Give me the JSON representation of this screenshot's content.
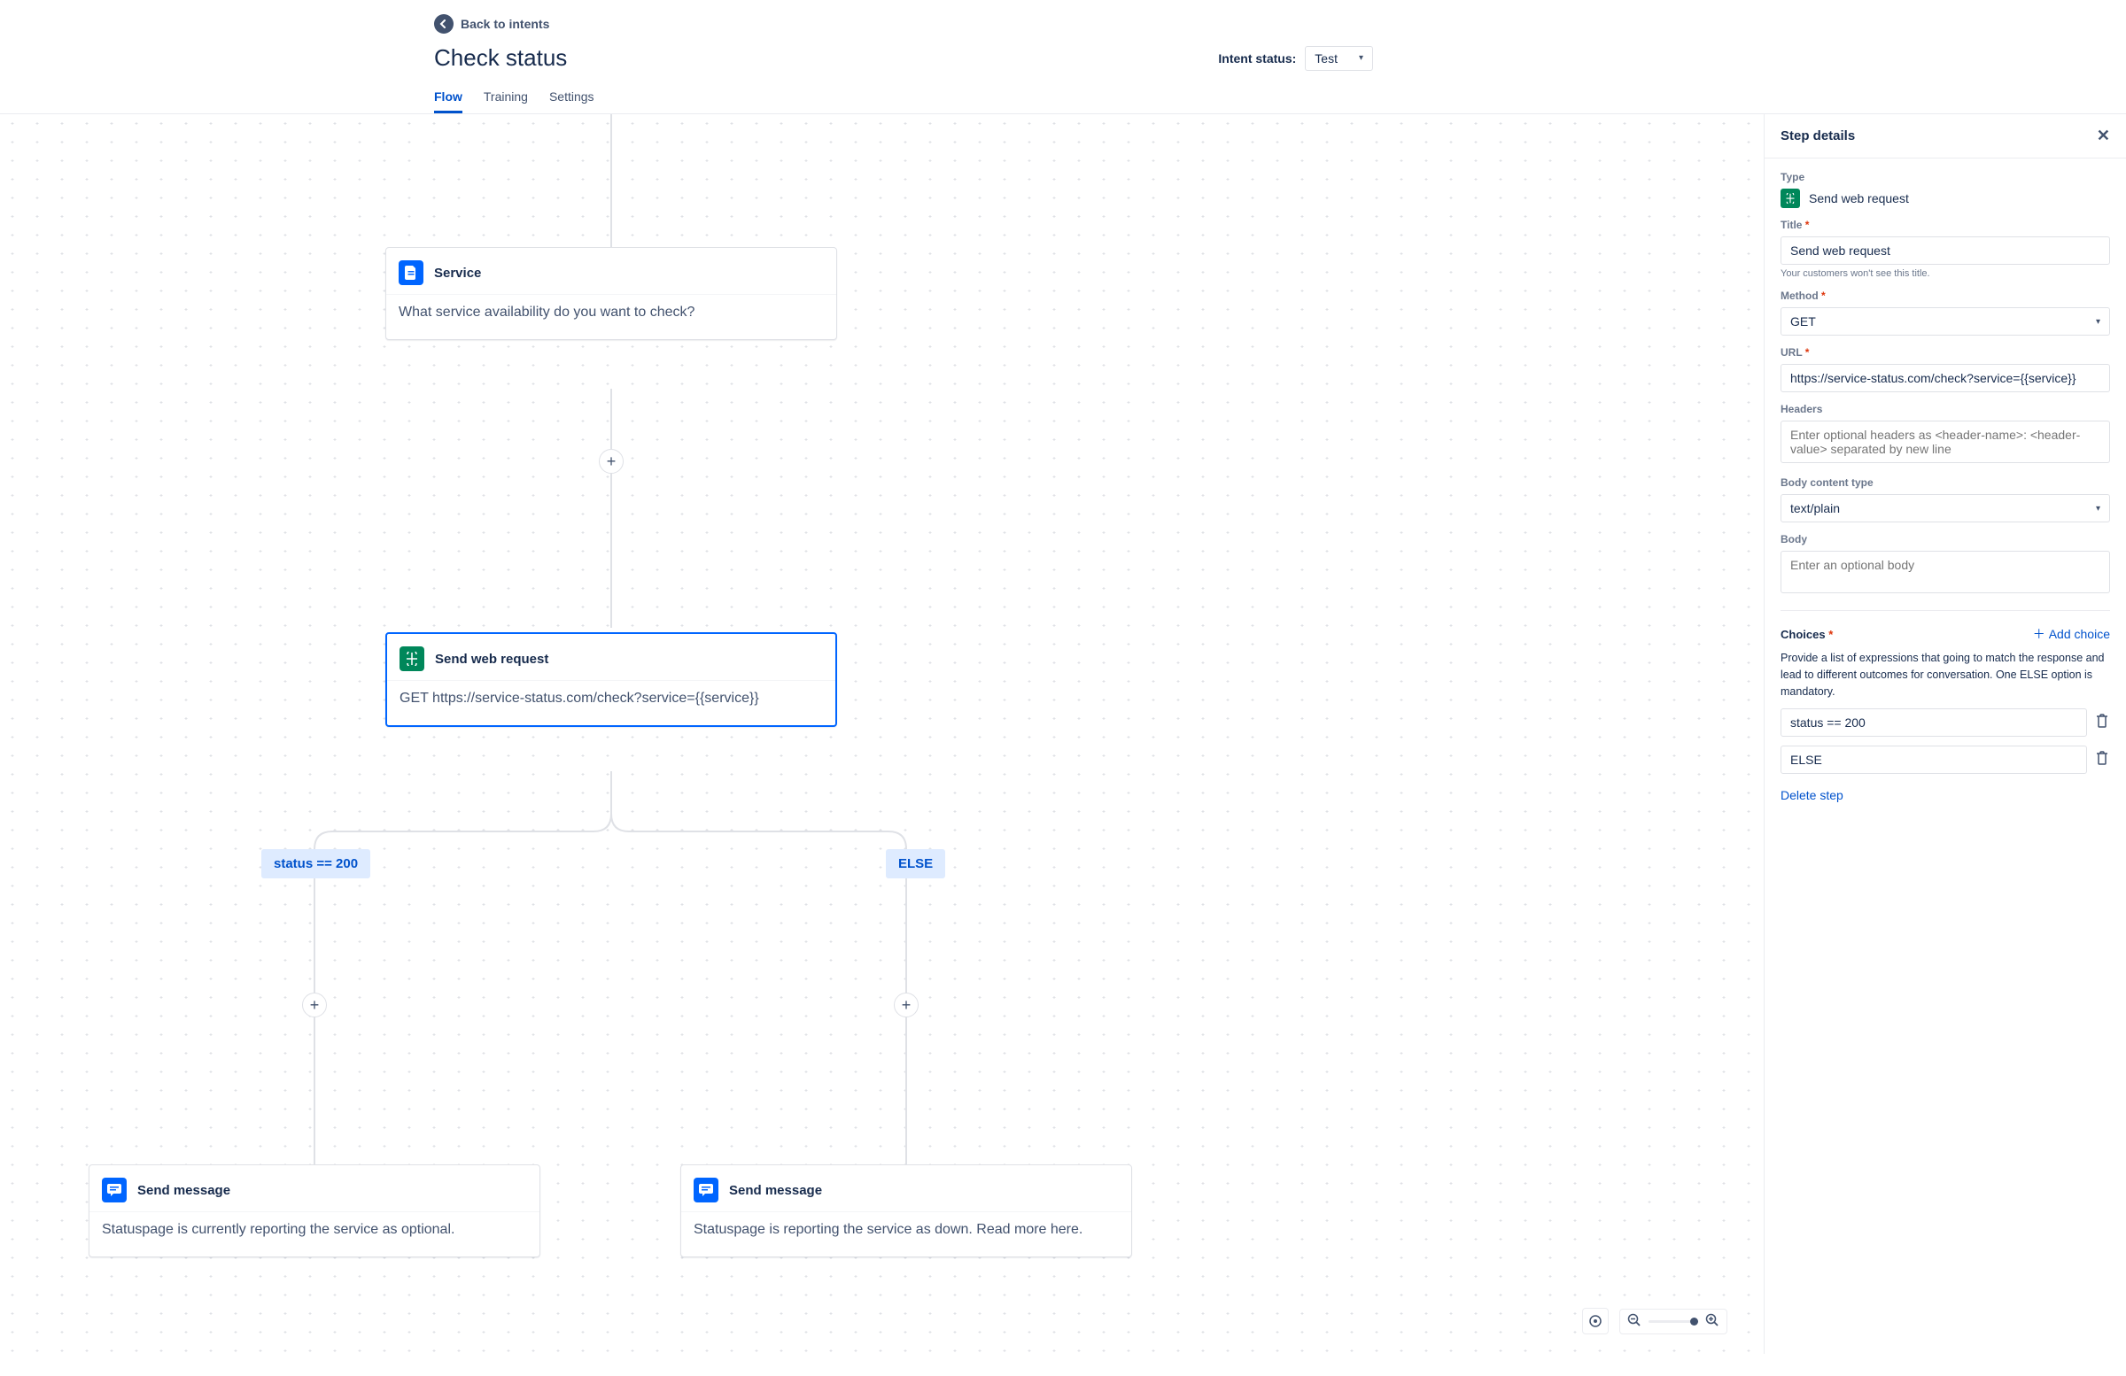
{
  "header": {
    "back_label": "Back to intents",
    "title": "Check status",
    "intent_status_label": "Intent status:",
    "intent_status_value": "Test"
  },
  "tabs": {
    "flow": "Flow",
    "training": "Training",
    "settings": "Settings"
  },
  "nodes": {
    "service": {
      "title": "Service",
      "body": "What service availability do you want to check?",
      "icon": "document-icon"
    },
    "webreq": {
      "title": "Send web request",
      "body": "GET https://service-status.com/check?service={{service}}",
      "icon": "web-request-icon"
    },
    "msg_up": {
      "title": "Send message",
      "body": "Statuspage is currently reporting the service as optional.",
      "icon": "message-icon"
    },
    "msg_down": {
      "title": "Send message",
      "body": "Statuspage is reporting the service as down. Read more here.",
      "icon": "message-icon"
    }
  },
  "branches": {
    "left": "status == 200",
    "right": "ELSE"
  },
  "panel": {
    "title": "Step details",
    "type_label": "Type",
    "type_value": "Send web request",
    "title_field_label": "Title",
    "title_field_value": "Send web request",
    "title_help": "Your customers won't see this title.",
    "method_label": "Method",
    "method_value": "GET",
    "url_label": "URL",
    "url_value": "https://service-status.com/check?service={{service}}",
    "headers_label": "Headers",
    "headers_placeholder": "Enter optional headers as <header-name>: <header-value> separated by new line",
    "body_type_label": "Body content type",
    "body_type_value": "text/plain",
    "body_label": "Body",
    "body_placeholder": "Enter an optional body",
    "choices_label": "Choices",
    "add_choice_label": "Add choice",
    "choices_desc": "Provide a list of expressions that going to match the response and lead to different outcomes for conversation. One ELSE option is mandatory.",
    "choice1": "status == 200",
    "choice2": "ELSE",
    "delete_step": "Delete step"
  },
  "toolbar": {
    "target": "target-icon",
    "zoom_out": "zoom-out-icon",
    "zoom_in": "zoom-in-icon"
  }
}
